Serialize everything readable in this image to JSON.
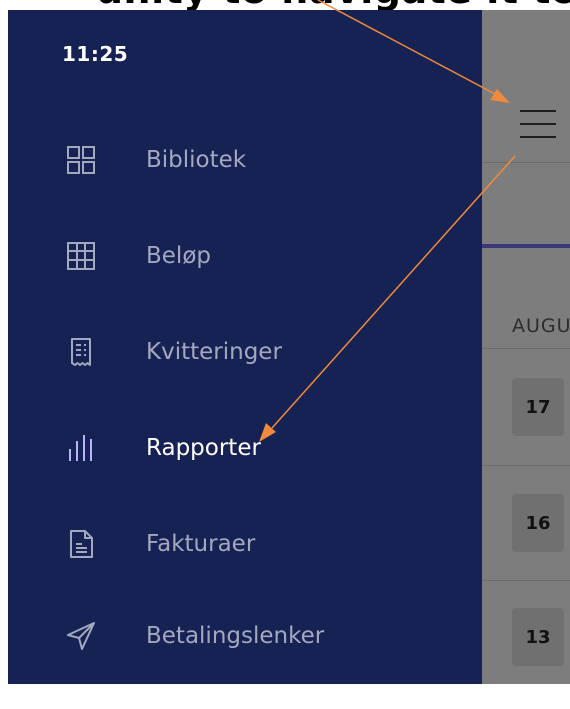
{
  "heading": {
    "text": "unity to navigate it to Rapporter page"
  },
  "status_bar": {
    "time": "11:25"
  },
  "drawer": {
    "items": [
      {
        "label": "Bibliotek",
        "icon": "grid-icon",
        "active": false
      },
      {
        "label": "Beløp",
        "icon": "table-icon",
        "active": false
      },
      {
        "label": "Kvitteringer",
        "icon": "receipt-icon",
        "active": false
      },
      {
        "label": "Rapporter",
        "icon": "bar-chart-icon",
        "active": true
      },
      {
        "label": "Fakturaer",
        "icon": "document-icon",
        "active": false
      },
      {
        "label": "Betalingslenker",
        "icon": "send-icon",
        "active": false
      }
    ]
  },
  "background_screen": {
    "month_label": "AUGU",
    "dates": [
      "17",
      "16",
      "13"
    ]
  },
  "colors": {
    "drawer_bg": "#172254",
    "inactive_label": "#a3a8bf",
    "active_label": "#ffffff",
    "active_icon": "#b9b3ff",
    "annotation_arrow": "#f08a3c",
    "overlay": "#7d7d7d"
  }
}
